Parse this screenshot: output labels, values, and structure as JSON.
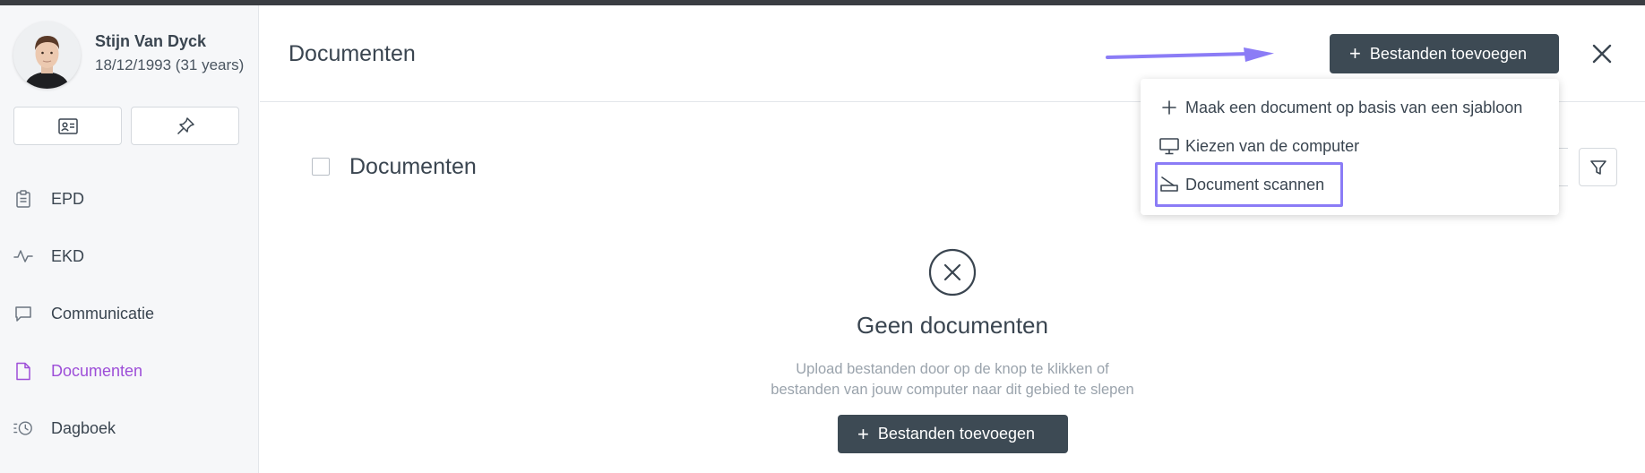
{
  "patient": {
    "name": "Stijn Van Dyck",
    "dob": "18/12/1993 (31 years)"
  },
  "sidebar": {
    "buttons": [
      {
        "icon": "id-card-icon"
      },
      {
        "icon": "pin-icon"
      }
    ],
    "items": [
      {
        "label": "EPD",
        "icon": "clipboard-icon"
      },
      {
        "label": "EKD",
        "icon": "activity-icon"
      },
      {
        "label": "Communicatie",
        "icon": "chat-icon"
      },
      {
        "label": "Documenten",
        "icon": "document-icon",
        "active": true
      },
      {
        "label": "Dagboek",
        "icon": "history-icon"
      }
    ]
  },
  "header": {
    "title": "Documenten",
    "add_button": "Bestanden toevoegen"
  },
  "dropdown": {
    "items": [
      {
        "label": "Maak een document op basis van een sjabloon",
        "icon": "plus-icon"
      },
      {
        "label": "Kiezen van de computer",
        "icon": "monitor-icon"
      },
      {
        "label": "Document scannen",
        "icon": "scanner-icon"
      }
    ]
  },
  "section": {
    "title": "Documenten"
  },
  "empty_state": {
    "title": "Geen documenten",
    "line1": "Upload bestanden door op de knop te klikken of",
    "line2": "bestanden van jouw computer naar dit gebied te slepen",
    "button": "Bestanden toevoegen"
  },
  "colors": {
    "accent": "#9d4ed8",
    "primary_button": "#3d4a54",
    "highlight": "#8b7cf6"
  }
}
